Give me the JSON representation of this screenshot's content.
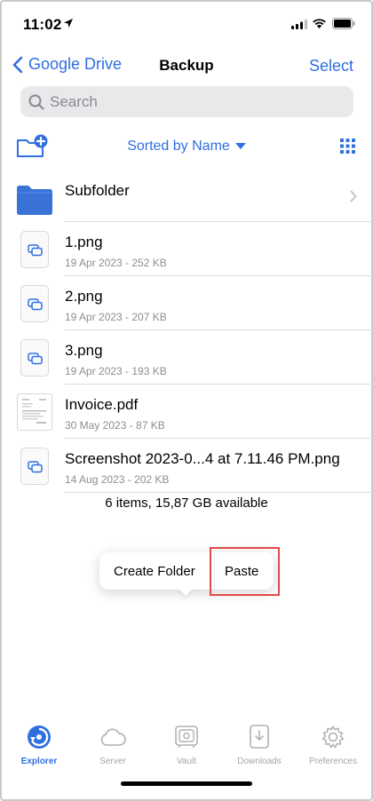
{
  "status": {
    "time": "11:02"
  },
  "nav": {
    "back_label": "Google Drive",
    "title": "Backup",
    "select_label": "Select"
  },
  "search": {
    "placeholder": "Search"
  },
  "toolbar": {
    "sort_label": "Sorted by Name"
  },
  "folder": {
    "name": "Subfolder"
  },
  "files": [
    {
      "name": "1.png",
      "meta": "19 Apr 2023 - 252 KB",
      "icon": "image-file-icon"
    },
    {
      "name": "2.png",
      "meta": "19 Apr 2023 - 207 KB",
      "icon": "image-file-icon"
    },
    {
      "name": "3.png",
      "meta": "19 Apr 2023 - 193 KB",
      "icon": "image-file-icon"
    },
    {
      "name": "Invoice.pdf",
      "meta": "30 May 2023 - 87 KB",
      "icon": "pdf-thumbnail-icon"
    },
    {
      "name": "Screenshot 2023-0...4 at 7.11.46 PM.png",
      "meta": "14 Aug 2023 - 202 KB",
      "icon": "image-file-icon"
    }
  ],
  "summary": "6 items, 15,87 GB available",
  "context_menu": {
    "create_folder": "Create Folder",
    "paste": "Paste"
  },
  "tabs": [
    {
      "label": "Explorer",
      "icon": "explorer-icon",
      "active": true
    },
    {
      "label": "Server",
      "icon": "cloud-icon",
      "active": false
    },
    {
      "label": "Vault",
      "icon": "vault-icon",
      "active": false
    },
    {
      "label": "Downloads",
      "icon": "download-icon",
      "active": false
    },
    {
      "label": "Preferences",
      "icon": "gear-icon",
      "active": false
    }
  ],
  "colors": {
    "accent": "#2f6fe0",
    "folder": "#3a73d8",
    "highlight": "#e14a4a"
  }
}
